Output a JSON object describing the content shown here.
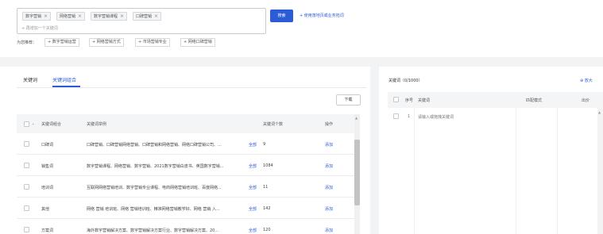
{
  "keywords": [
    "数字营销",
    "网络营销",
    "数字营销课程",
    "口碑营销"
  ],
  "add_keyword": "+ 再增加一个关键词",
  "search_label": "搜索",
  "extract_link": "+ 使用落地页或业务拓词",
  "recommend_label": "为您推荐：",
  "recommendations": [
    "+ 数字营销运营",
    "+ 网络营销方式",
    "+ 市场营销专业",
    "+ 网络口碑营销"
  ],
  "tabs": [
    "关键词",
    "关键词组合"
  ],
  "download_label": "下载",
  "table": {
    "headers": {
      "group": "关键词组合",
      "examples": "关键词举例",
      "count": "关键词个数",
      "action": "操作"
    },
    "more_label": "全部",
    "add_label": "添加",
    "rows": [
      {
        "group": "口碑词",
        "examples": "口碑营销、口碑营销网络营销、口碑营销和网络营销、网络口碑营销公司、...",
        "count": "9"
      },
      {
        "group": "销售词",
        "examples": "数字营销课程、网络营销、数字营销、2021数字营销白皮书、英国数字营销...",
        "count": "1084"
      },
      {
        "group": "培训词",
        "examples": "互联网网络营销培训、数字营销专业课程、电商网络营销培训班、百度网络...",
        "count": "11"
      },
      {
        "group": "其他",
        "examples": "网络 营销 培训班、网络 营销培训班、精准网络营销教学好、网络 营销 入...",
        "count": "142"
      },
      {
        "group": "方案词",
        "examples": "海外数字营销解决方案、数字营销解决方案行业、数字营销解决方案、20...",
        "count": "120"
      }
    ]
  },
  "right": {
    "title": "关键词（0/1000）",
    "zoom_label": "放大",
    "headers": {
      "index": "序号",
      "keyword": "关键词",
      "match": "匹配模式",
      "bid": "出价"
    },
    "rows": [
      {
        "index": "1",
        "keyword": "请输入或拖拽关键词"
      }
    ]
  },
  "colors": {
    "accent": "#2c5bd6",
    "background": "#f2f3f5",
    "panel": "#ffffff"
  }
}
